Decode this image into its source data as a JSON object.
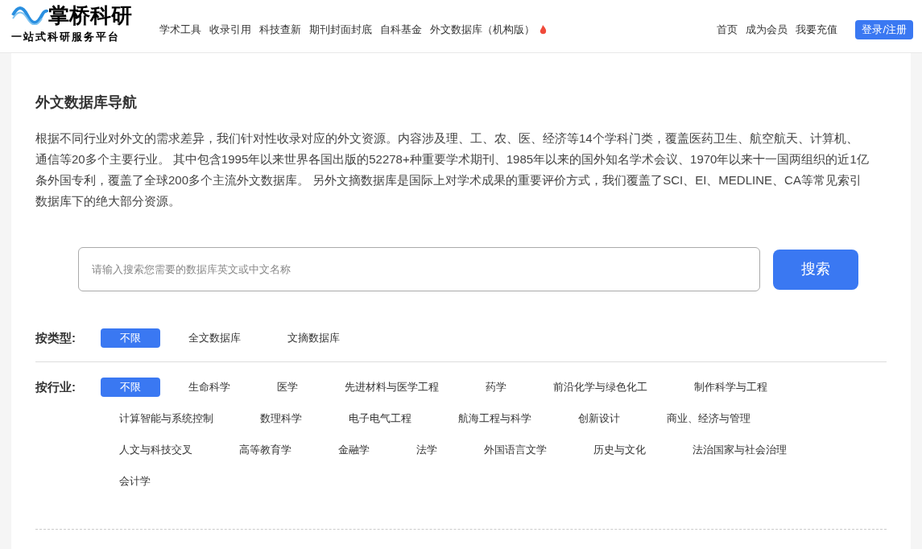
{
  "header": {
    "logo_text": "掌桥科研",
    "logo_tagline": "一站式科研服务平台",
    "nav": [
      {
        "label": "学术工具"
      },
      {
        "label": "收录引用"
      },
      {
        "label": "科技查新"
      },
      {
        "label": "期刊封面封底"
      },
      {
        "label": "自科基金"
      },
      {
        "label": "外文数据库（机构版）",
        "hot": true
      }
    ],
    "links": [
      "首页",
      "成为会员",
      "我要充值"
    ],
    "login": "登录/注册"
  },
  "page": {
    "title": "外文数据库导航",
    "intro": "根据不同行业对外文的需求差异，我们针对性收录对应的外文资源。内容涉及理、工、农、医、经济等14个学科门类，覆盖医药卫生、航空航天、计算机、通信等20多个主要行业。 其中包含1995年以来世界各国出版的52278+种重要学术期刊、1985年以来的国外知名学术会议、1970年以来十一国两组织的近1亿条外国专利，覆盖了全球200多个主流外文数据库。 另外文摘数据库是国际上对学术成果的重要评价方式，我们覆盖了SCI、EI、MEDLINE、CA等常见索引数据库下的绝大部分资源。"
  },
  "search": {
    "placeholder": "请输入搜索您需要的数据库英文或中文名称",
    "button": "搜索"
  },
  "filters": [
    {
      "label": "按类型:",
      "options": [
        {
          "label": "不限",
          "selected": true
        },
        {
          "label": "全文数据库",
          "selected": false
        },
        {
          "label": "文摘数据库",
          "selected": false
        }
      ]
    },
    {
      "label": "按行业:",
      "options": [
        {
          "label": "不限",
          "selected": true
        },
        {
          "label": "生命科学",
          "selected": false
        },
        {
          "label": "医学",
          "selected": false
        },
        {
          "label": "先进材料与医学工程",
          "selected": false
        },
        {
          "label": "药学",
          "selected": false
        },
        {
          "label": "前沿化学与绿色化工",
          "selected": false
        },
        {
          "label": "制作科学与工程",
          "selected": false
        },
        {
          "label": "计算智能与系统控制",
          "selected": false
        },
        {
          "label": "数理科学",
          "selected": false
        },
        {
          "label": "电子电气工程",
          "selected": false
        },
        {
          "label": "航海工程与科学",
          "selected": false
        },
        {
          "label": "创新设计",
          "selected": false
        },
        {
          "label": "商业、经济与管理",
          "selected": false
        },
        {
          "label": "人文与科技交叉",
          "selected": false
        },
        {
          "label": "高等教育学",
          "selected": false
        },
        {
          "label": "金融学",
          "selected": false
        },
        {
          "label": "法学",
          "selected": false
        },
        {
          "label": "外国语言文学",
          "selected": false
        },
        {
          "label": "历史与文化",
          "selected": false
        },
        {
          "label": "法治国家与社会治理",
          "selected": false
        },
        {
          "label": "会计学",
          "selected": false
        }
      ]
    }
  ]
}
